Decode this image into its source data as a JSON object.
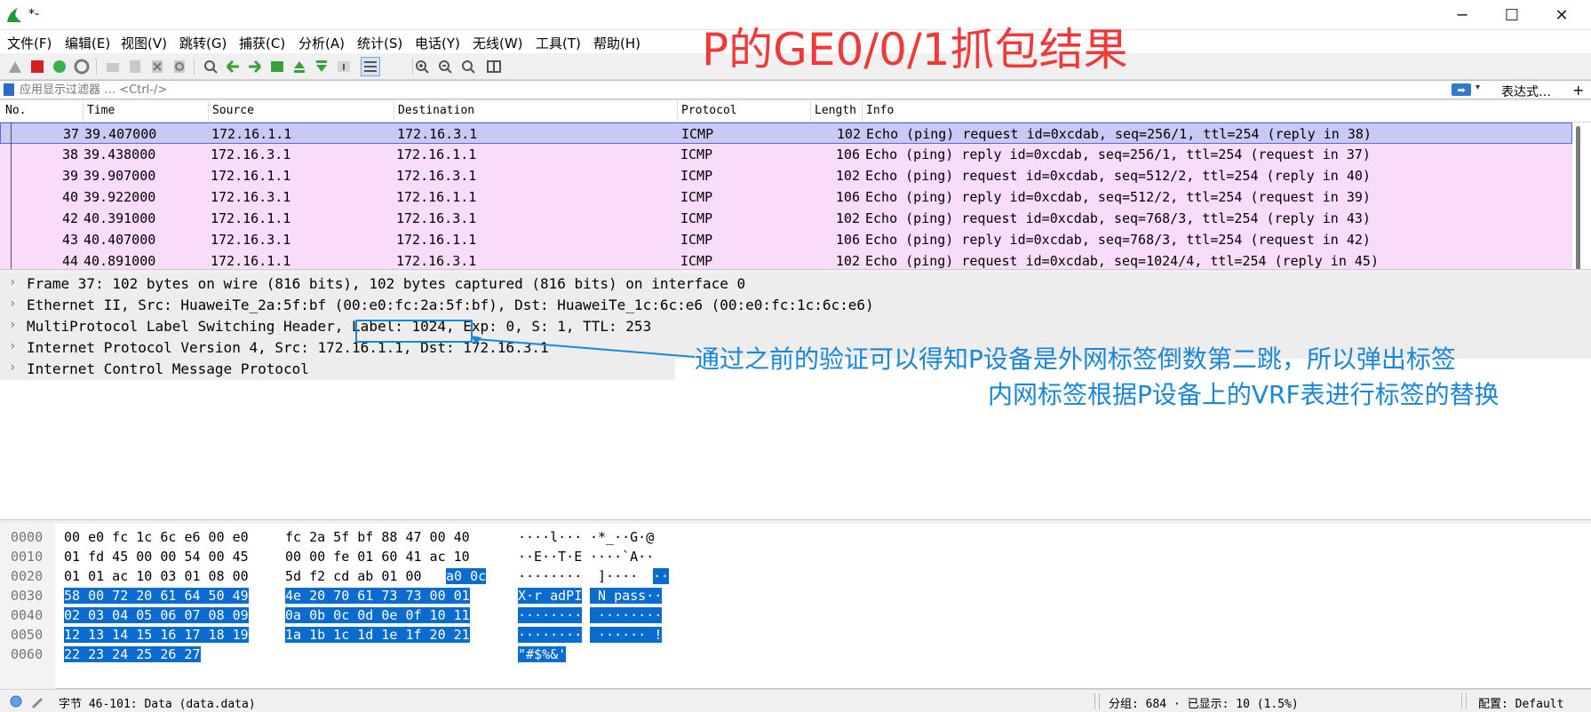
{
  "window": {
    "title": "*-",
    "minimize_glyph": "─",
    "maximize_glyph": "☐",
    "close_glyph": "✕"
  },
  "menu": [
    "文件(F)",
    "编辑(E)",
    "视图(V)",
    "跳转(G)",
    "捕获(C)",
    "分析(A)",
    "统计(S)",
    "电话(Y)",
    "无线(W)",
    "工具(T)",
    "帮助(H)"
  ],
  "annotation": {
    "title": "P的GE0/0/1抓包结果",
    "note_line1": "通过之前的验证可以得知P设备是外网标签倒数第二跳，所以弹出标签",
    "note_line2": "内网标签根据P设备上的VRF表进行标签的替换",
    "title_color": "#f03a3a",
    "note_color": "#1a86d9"
  },
  "filter": {
    "placeholder": "应用显示过滤器 … <Ctrl-/>",
    "apply_glyph": "➡",
    "dropdown_glyph": "▾",
    "expression_label": "表达式…",
    "add_glyph": "+"
  },
  "packet_list": {
    "columns": [
      "No.",
      "Time",
      "Source",
      "Destination",
      "Protocol",
      "Length",
      "Info"
    ],
    "rows": [
      {
        "no": "37",
        "time": "39.407000",
        "src": "172.16.1.1",
        "dst": "172.16.3.1",
        "proto": "ICMP",
        "len": "102",
        "info": "Echo (ping) request  id=0xcdab, seq=256/1, ttl=254 (reply in 38)"
      },
      {
        "no": "38",
        "time": "39.438000",
        "src": "172.16.3.1",
        "dst": "172.16.1.1",
        "proto": "ICMP",
        "len": "106",
        "info": "Echo (ping) reply    id=0xcdab, seq=256/1, ttl=254 (request in 37)"
      },
      {
        "no": "39",
        "time": "39.907000",
        "src": "172.16.1.1",
        "dst": "172.16.3.1",
        "proto": "ICMP",
        "len": "102",
        "info": "Echo (ping) request  id=0xcdab, seq=512/2, ttl=254 (reply in 40)"
      },
      {
        "no": "40",
        "time": "39.922000",
        "src": "172.16.3.1",
        "dst": "172.16.1.1",
        "proto": "ICMP",
        "len": "106",
        "info": "Echo (ping) reply    id=0xcdab, seq=512/2, ttl=254 (request in 39)"
      },
      {
        "no": "42",
        "time": "40.391000",
        "src": "172.16.1.1",
        "dst": "172.16.3.1",
        "proto": "ICMP",
        "len": "102",
        "info": "Echo (ping) request  id=0xcdab, seq=768/3, ttl=254 (reply in 43)"
      },
      {
        "no": "43",
        "time": "40.407000",
        "src": "172.16.3.1",
        "dst": "172.16.1.1",
        "proto": "ICMP",
        "len": "106",
        "info": "Echo (ping) reply    id=0xcdab, seq=768/3, ttl=254 (request in 42)"
      },
      {
        "no": "44",
        "time": "40.891000",
        "src": "172.16.1.1",
        "dst": "172.16.3.1",
        "proto": "ICMP",
        "len": "102",
        "info": "Echo (ping) request  id=0xcdab, seq=1024/4, ttl=254 (reply in 45)"
      }
    ],
    "selected_row_color": "#c8c9f4",
    "icmp_row_color": "#f9dcf9"
  },
  "details": [
    "Frame 37: 102 bytes on wire (816 bits), 102 bytes captured (816 bits) on interface 0",
    "Ethernet II, Src: HuaweiTe_2a:5f:bf (00:e0:fc:2a:5f:bf), Dst: HuaweiTe_1c:6c:e6 (00:e0:fc:1c:6c:e6)",
    "MultiProtocol Label Switching Header, Label: 1024, Exp: 0, S: 1, TTL: 253",
    "Internet Protocol Version 4, Src: 172.16.1.1, Dst: 172.16.3.1",
    "Internet Control Message Protocol"
  ],
  "bytes": [
    {
      "offset": "0000",
      "hex_a": "00 e0 fc 1c 6c e6 00 e0",
      "hex_b": "fc 2a 5f bf 88 47 00 40",
      "ascii_a": "····l···",
      "ascii_b": "·*_··G·@"
    },
    {
      "offset": "0010",
      "hex_a": "01 fd 45 00 00 54 00 45",
      "hex_b": "00 00 fe 01 60 41 ac 10",
      "ascii_a": "··E··T·E",
      "ascii_b": "····`A··"
    },
    {
      "offset": "0020",
      "hex_a": "01 01 ac 10 03 01 08 00",
      "hex_b_plain": "5d f2 cd ab 01 00 ",
      "hex_b_hl": "a0 0c",
      "ascii_a": "········",
      "ascii_b_plain": " ]····",
      "ascii_b_hl": "··"
    },
    {
      "offset": "0030",
      "hex_a": "58 00 72 20 61 64 50 49",
      "hex_b": "4e 20 70 61 73 73 00 01",
      "ascii_a": "X·r adPI",
      "ascii_b": " N pass··"
    },
    {
      "offset": "0040",
      "hex_a": "02 03 04 05 06 07 08 09",
      "hex_b": "0a 0b 0c 0d 0e 0f 10 11",
      "ascii_a": "········",
      "ascii_b": " ········"
    },
    {
      "offset": "0050",
      "hex_a": "12 13 14 15 16 17 18 19",
      "hex_b": "1a 1b 1c 1d 1e 1f 20 21",
      "ascii_a": "········",
      "ascii_b": " ······ !"
    },
    {
      "offset": "0060",
      "hex_a": "22 23 24 25 26 27",
      "hex_b": "",
      "ascii_a": "\"#$%&'",
      "ascii_b": ""
    }
  ],
  "status": {
    "field": "字节 46-101: Data (data.data)",
    "packets": "分组: 684 · 已显示: 10 (1.5%)",
    "profile": "配置: Default"
  }
}
